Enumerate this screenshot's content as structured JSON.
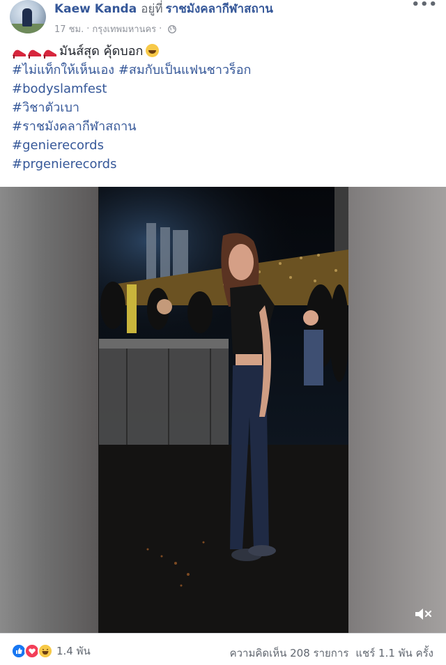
{
  "post": {
    "author": "Kaew Kanda",
    "at_text": "อยู่ที่",
    "place": "ราชมังคลากีฬาสถาน",
    "time": "17 ชม.",
    "location": "กรุงเทพมหานคร",
    "privacy_icon": "globe-icon",
    "caption": "มันส์สุด คุ้ดบอก",
    "hashtags": [
      "#ไม่แท็กให้เห็นเอง #สมกับเป็นแฟนชาวร็อก",
      "#bodyslamfest",
      "#วิชาตัวเบา",
      "#ราชมังคลากีฬาสถาน",
      "#genierecords",
      "#prgenierecords"
    ]
  },
  "footer": {
    "reaction_count": "1.4 พัน",
    "comments": "ความคิดเห็น 208 รายการ",
    "shares": "แชร์ 1.1 พัน ครั้ง"
  },
  "colors": {
    "link": "#365899",
    "muted": "#616770",
    "like": "#1877f2",
    "love": "#f33e58",
    "haha": "#f7c948"
  }
}
